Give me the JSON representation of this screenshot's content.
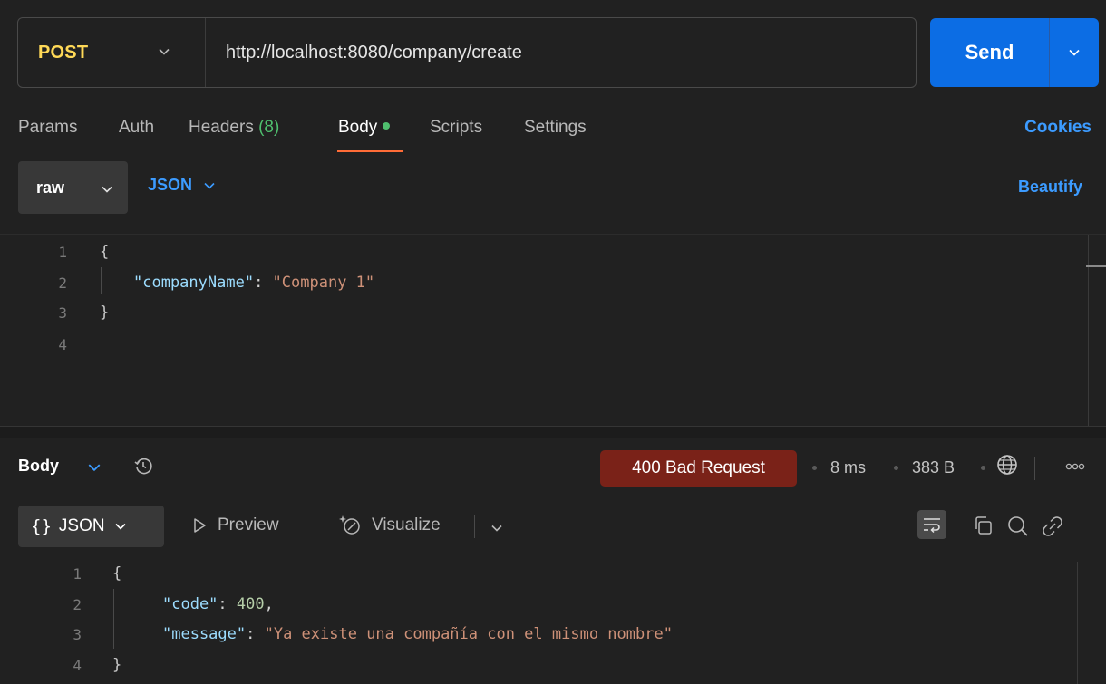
{
  "request": {
    "method": "POST",
    "url": "http://localhost:8080/company/create",
    "send_label": "Send"
  },
  "tabs": [
    {
      "label": "Params"
    },
    {
      "label": "Auth"
    },
    {
      "label": "Headers",
      "count": "(8)"
    },
    {
      "label": "Body"
    },
    {
      "label": "Scripts"
    },
    {
      "label": "Settings"
    }
  ],
  "cookies_label": "Cookies",
  "body_toolbar": {
    "mode": "raw",
    "format": "JSON",
    "beautify_label": "Beautify"
  },
  "request_body": {
    "line_numbers": [
      "1",
      "2",
      "3",
      "4"
    ],
    "open_brace": "{",
    "key": "\"companyName\"",
    "colon": ": ",
    "value": "\"Company 1\"",
    "close_brace": "}"
  },
  "response": {
    "body_label": "Body",
    "status": "400 Bad Request",
    "time": "8 ms",
    "size": "383 B",
    "status_color": "#7a2218"
  },
  "response_toolbar": {
    "format": "JSON",
    "curly": "{}",
    "preview_label": "Preview",
    "visualize_label": "Visualize"
  },
  "response_body": {
    "line_numbers": [
      "1",
      "2",
      "3",
      "4"
    ],
    "open_brace": "{",
    "code_key": "\"code\"",
    "code_colon": ": ",
    "code_value": "400",
    "code_comma": ",",
    "message_key": "\"message\"",
    "message_colon": ": ",
    "message_value": "\"Ya existe una compañía con el mismo nombre\"",
    "close_brace": "}"
  },
  "colors": {
    "accent_blue": "#0c6de4",
    "link_blue": "#3c9bff",
    "method_yellow": "#ffd957",
    "tab_underline": "#ff6c37",
    "success_green": "#4fbf6e"
  }
}
